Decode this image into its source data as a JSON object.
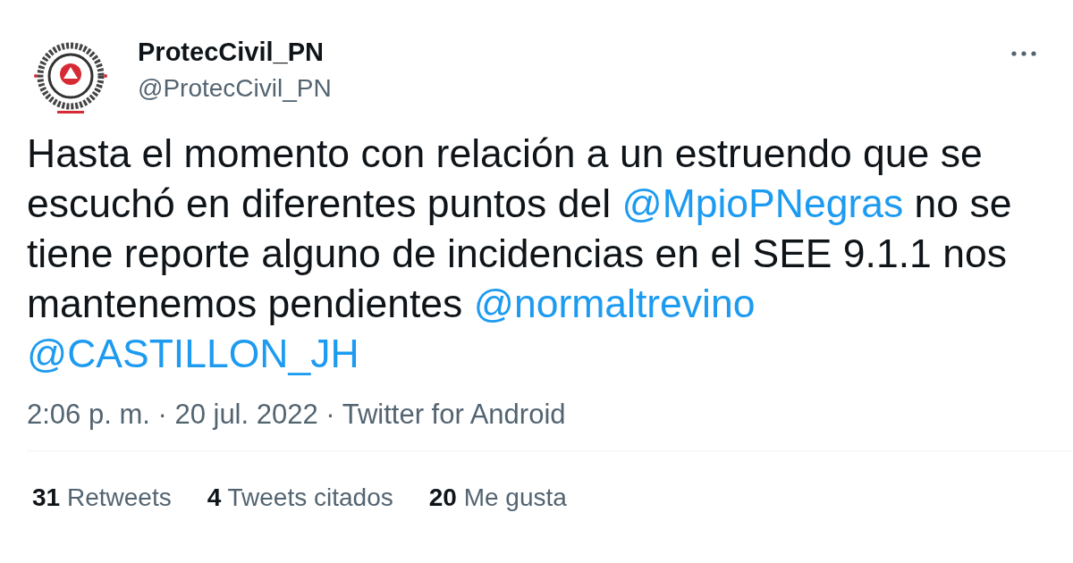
{
  "author": {
    "name": "ProtecCivil_PN",
    "handle": "@ProtecCivil_PN"
  },
  "body": [
    {
      "kind": "text",
      "text": "Hasta el momento con relación a un estruendo que se escuchó en diferentes puntos del "
    },
    {
      "kind": "mention",
      "text": "@MpioPNegras"
    },
    {
      "kind": "text",
      "text": " no se tiene reporte alguno de incidencias en el SEE 9.1.1 nos mantenemos pendientes "
    },
    {
      "kind": "mention",
      "text": "@normaltrevino"
    },
    {
      "kind": "mention",
      "text": "@CASTILLON_JH"
    }
  ],
  "meta": "2:06 p. m. · 20 jul. 2022 · Twitter for Android",
  "stats": [
    {
      "count": "31",
      "label": "Retweets"
    },
    {
      "count": "4",
      "label": "Tweets citados"
    },
    {
      "count": "20",
      "label": "Me gusta"
    }
  ]
}
